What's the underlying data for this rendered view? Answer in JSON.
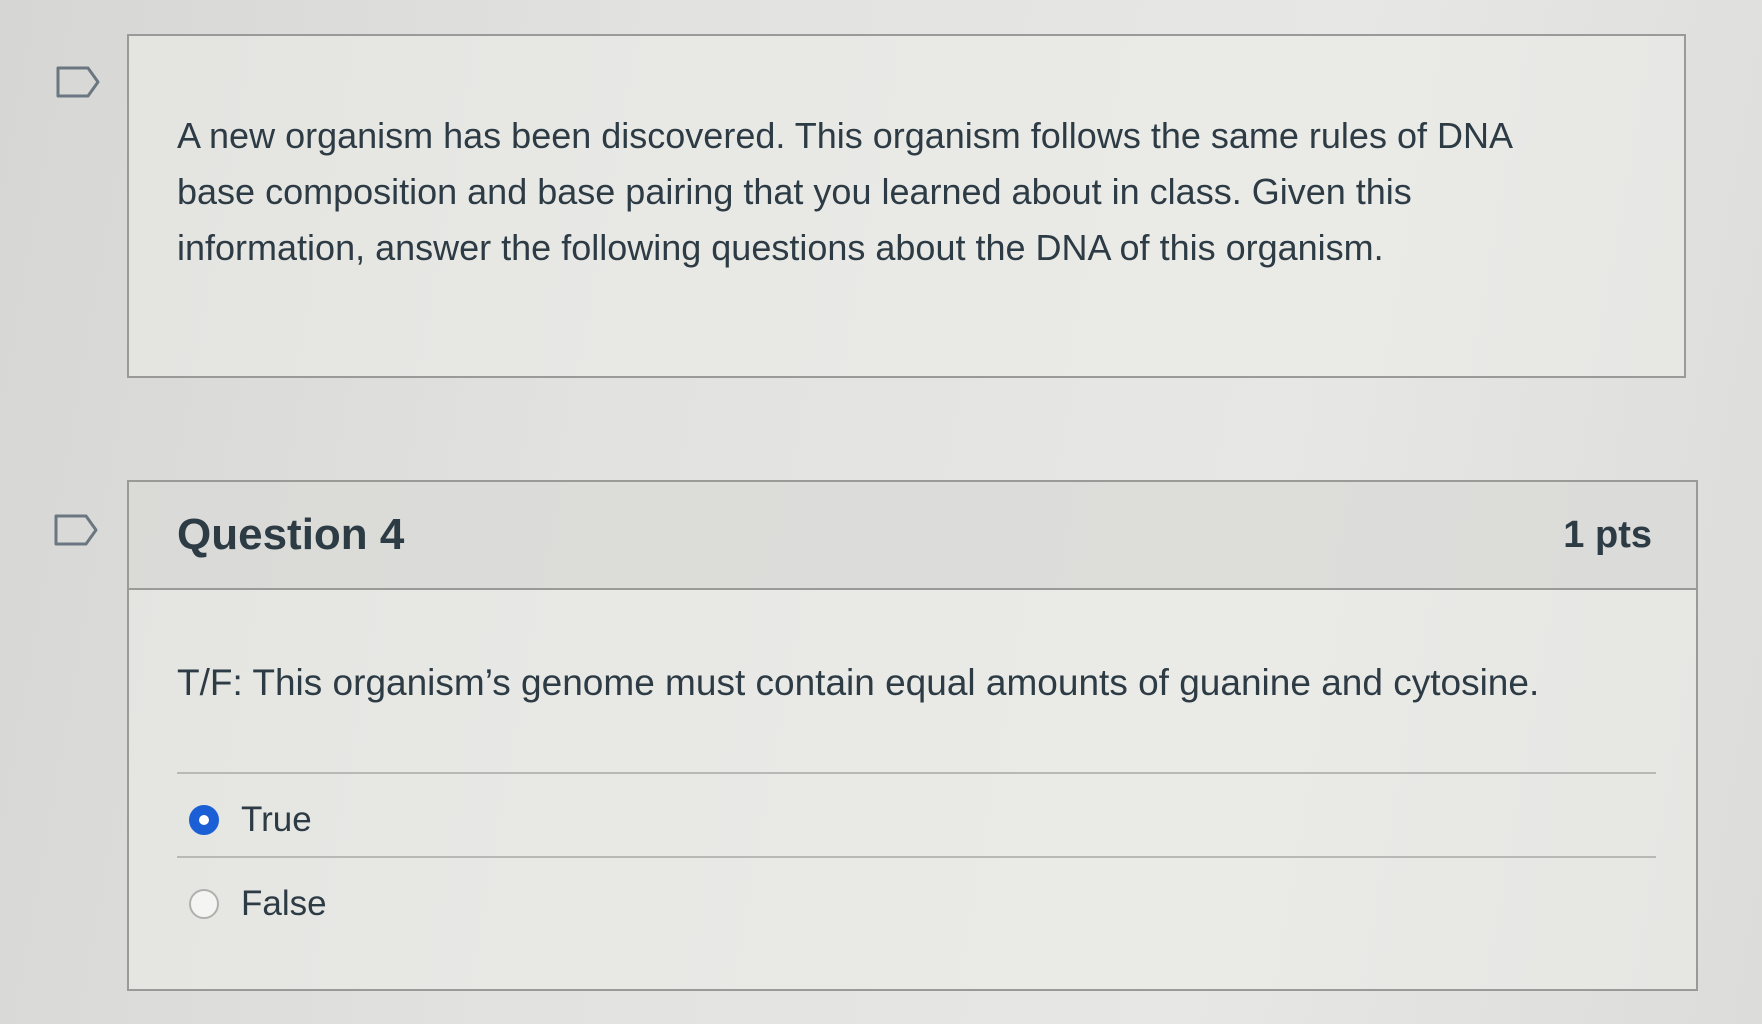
{
  "stimulus": {
    "text": "A new organism has been discovered. This organism follows the same rules of DNA base composition and base pairing that you learned about in class. Given this information, answer the following questions about the DNA of this organism."
  },
  "question": {
    "title": "Question 4",
    "points": "1 pts",
    "text": "T/F: This organism’s genome must contain equal amounts of guanine and cytosine.",
    "answers": [
      {
        "label": "True",
        "selected": true
      },
      {
        "label": "False",
        "selected": false
      }
    ]
  },
  "icons": {
    "flag": "flag-question-icon"
  },
  "colors": {
    "text": "#2d3b45",
    "radio_selected": "#1b5fd6",
    "border": "#9a9a98"
  }
}
